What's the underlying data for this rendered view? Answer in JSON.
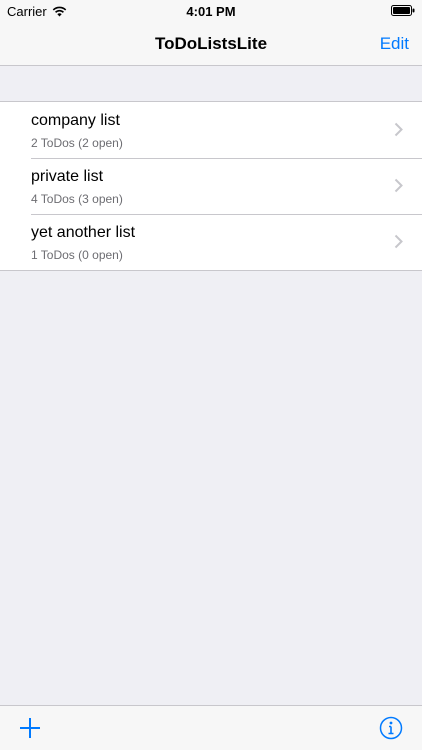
{
  "status_bar": {
    "carrier": "Carrier",
    "time": "4:01 PM",
    "wifi_icon": "wifi-icon",
    "battery_icon": "battery-icon"
  },
  "nav": {
    "title": "ToDoListsLite",
    "edit_label": "Edit"
  },
  "lists": [
    {
      "title": "company list",
      "subtitle": "2 ToDos (2 open)"
    },
    {
      "title": "private list",
      "subtitle": "4 ToDos (3 open)"
    },
    {
      "title": "yet another list",
      "subtitle": "1 ToDos (0 open)"
    }
  ],
  "toolbar": {
    "add_icon": "plus-icon",
    "info_icon": "info-icon"
  },
  "colors": {
    "accent": "#007aff",
    "background": "#efeff4",
    "bar": "#f7f7f7",
    "separator": "#c8c7cc",
    "subtitle": "#6d6d72"
  }
}
